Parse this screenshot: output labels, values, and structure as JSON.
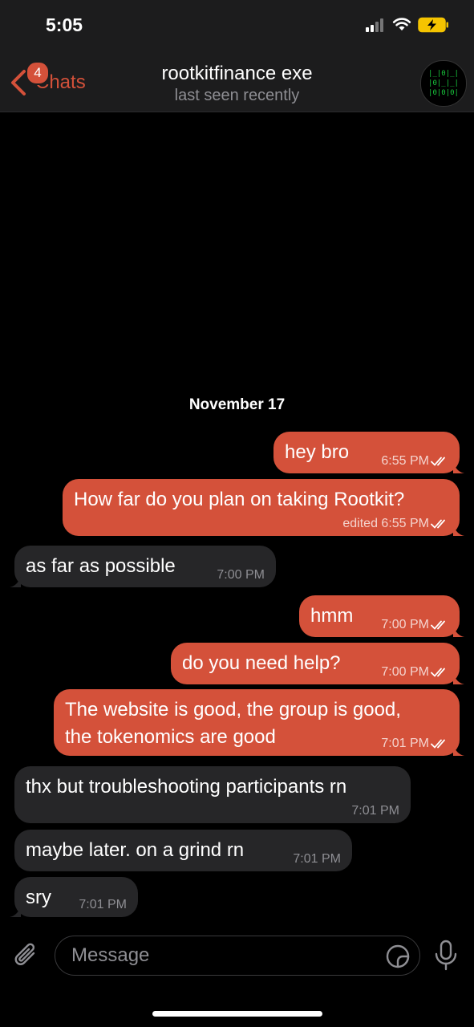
{
  "status": {
    "time": "5:05"
  },
  "nav": {
    "back_label": "Chats",
    "unread_badge": "4",
    "title": "rootkitfinance exe",
    "subtitle": "last seen recently"
  },
  "chat": {
    "date_header": "November 17",
    "messages": [
      {
        "direction": "out",
        "text": "hey bro",
        "time": "6:55 PM",
        "read": true
      },
      {
        "direction": "out",
        "text": "How far do you plan on taking Rootkit?",
        "time": "edited 6:55 PM",
        "read": true
      },
      {
        "direction": "in",
        "text": "as far as possible",
        "time": "7:00 PM"
      },
      {
        "direction": "out",
        "text": "hmm",
        "time": "7:00 PM",
        "read": true
      },
      {
        "direction": "out",
        "text": "do you need help?",
        "time": "7:00 PM",
        "read": true
      },
      {
        "direction": "out",
        "text_line1": "The website is good, the group is good,",
        "text_line2": "the tokenomics are good",
        "time": "7:01 PM",
        "read": true
      },
      {
        "direction": "in",
        "text": "thx but troubleshooting participants rn",
        "time": "7:01 PM"
      },
      {
        "direction": "in",
        "text": "maybe later. on a grind rn",
        "time": "7:01 PM"
      },
      {
        "direction": "in",
        "text": "sry",
        "time": "7:01 PM"
      }
    ]
  },
  "input": {
    "placeholder": "Message"
  },
  "colors": {
    "accent": "#d4513a",
    "incoming_bubble": "#262628",
    "bar_background": "#1c1c1d",
    "secondary_text": "#8e8e93"
  },
  "icons": [
    "back-chevron-icon",
    "signal-icon",
    "wifi-icon",
    "battery-charging-icon",
    "read-checks-icon",
    "paperclip-icon",
    "sticker-icon",
    "microphone-icon"
  ]
}
